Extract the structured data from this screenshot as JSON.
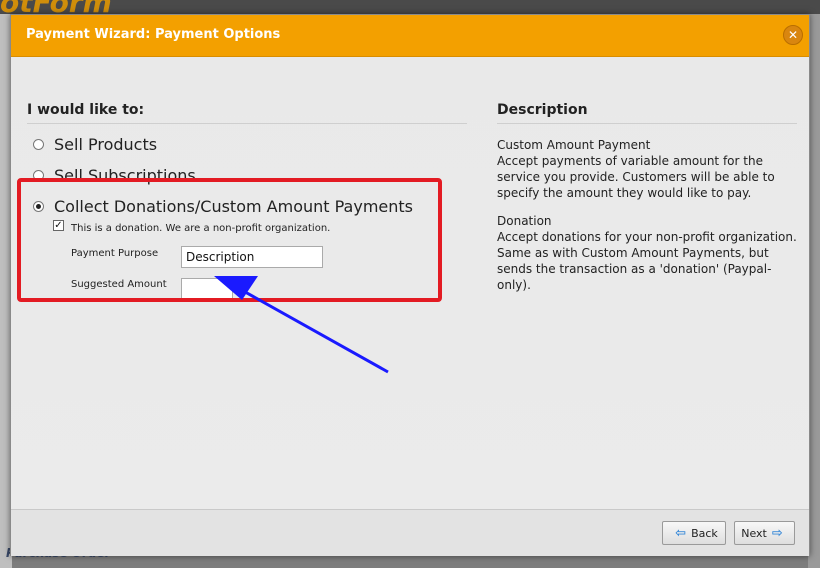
{
  "background": {
    "logo_text": "otForm",
    "bottom_text": "Purchase Order"
  },
  "modal": {
    "title": "Payment Wizard: Payment Options",
    "close_icon": "close-icon",
    "left": {
      "heading": "I would like to:",
      "options": [
        {
          "label": "Sell Products",
          "selected": false
        },
        {
          "label": "Sell Subscriptions",
          "selected": false
        },
        {
          "label": "Collect Donations/Custom Amount Payments",
          "selected": true
        }
      ],
      "donation_checkbox": {
        "label": "This is a donation. We are a non-profit organization.",
        "checked": true
      },
      "payment_purpose": {
        "label": "Payment Purpose",
        "value": "Description"
      },
      "suggested_amount": {
        "label": "Suggested Amount",
        "value": ""
      }
    },
    "right": {
      "heading": "Description",
      "custom_title": "Custom Amount Payment",
      "custom_text": "Accept payments of variable amount for the service you provide. Customers will be able to specify the amount they would like to pay.",
      "donation_title": "Donation",
      "donation_text": "Accept donations for your non-profit organization. Same as with Custom Amount Payments, but sends the transaction as a 'donation' (Paypal-only)."
    },
    "footer": {
      "back_label": "Back",
      "next_label": "Next"
    }
  },
  "colors": {
    "titlebar": "#f3a000",
    "highlight": "#e31b23",
    "annotation_arrow": "#1a1aff"
  }
}
